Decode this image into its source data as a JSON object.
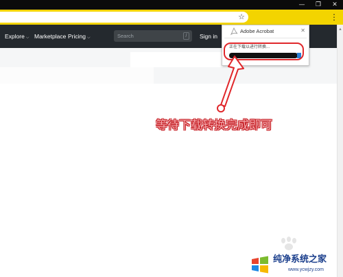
{
  "window": {
    "minimize_glyph": "—",
    "restore_glyph": "❐",
    "close_glyph": "✕"
  },
  "address_bar": {
    "bookmark_icon": "star-outline-icon",
    "bookmark_glyph": "☆",
    "menu_glyph": "⋮",
    "accent_color": "#f3d400"
  },
  "site_header": {
    "nav": [
      {
        "label": "Explore",
        "has_dropdown": true
      },
      {
        "label": "Marketplace",
        "has_dropdown": false
      },
      {
        "label": "Pricing",
        "has_dropdown": true
      }
    ],
    "caret_glyph": "⌵",
    "search_placeholder": "Search",
    "search_shortcut": "/",
    "sign_in": "Sign in",
    "background_color": "#24292e"
  },
  "acrobat_popup": {
    "title": "Adobe Acrobat",
    "close_glyph": "✕",
    "status": "正在下载以进行转换...",
    "progress": 0.95
  },
  "annotation": {
    "caption": "等待下载转换完成即可",
    "color": "#e0262a"
  },
  "watermark": {
    "title": "纯净系统之家",
    "url": "www.ycwjzy.com"
  }
}
